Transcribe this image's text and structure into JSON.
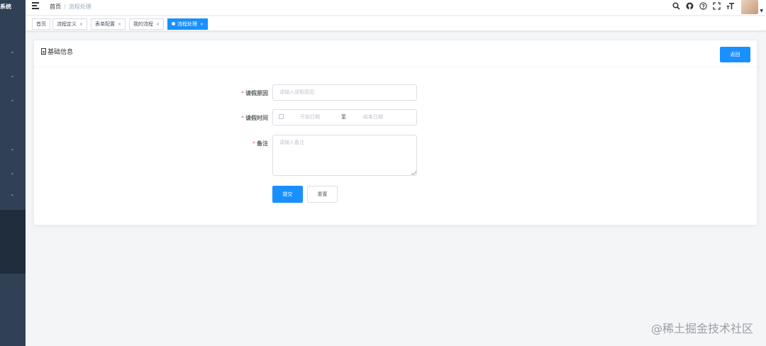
{
  "sidebar": {
    "title": "系统"
  },
  "breadcrumb": {
    "home": "首页",
    "separator": "/",
    "current": "流程处理"
  },
  "tags": [
    {
      "label": "首页",
      "close": ""
    },
    {
      "label": "流程定义",
      "close": "×"
    },
    {
      "label": "表单配置",
      "close": "×"
    },
    {
      "label": "我的流程",
      "close": "×"
    },
    {
      "label": "流程处理",
      "close": "×"
    }
  ],
  "card": {
    "title": "基础信息",
    "back_label": "返回"
  },
  "form": {
    "reason": {
      "label": "请假原因",
      "required": "*",
      "placeholder": "请输入请假原因"
    },
    "time": {
      "label": "请假时间",
      "required": "*",
      "start_placeholder": "开始日期",
      "separator": "至",
      "end_placeholder": "结束日期"
    },
    "remark": {
      "label": "备注",
      "required": "*",
      "placeholder": "请输入备注"
    },
    "submit_label": "提交",
    "reset_label": "重置"
  },
  "watermark": "@稀土掘金技术社区",
  "colors": {
    "primary": "#1890ff",
    "sidebar": "#304156",
    "required": "#f56c6c"
  }
}
